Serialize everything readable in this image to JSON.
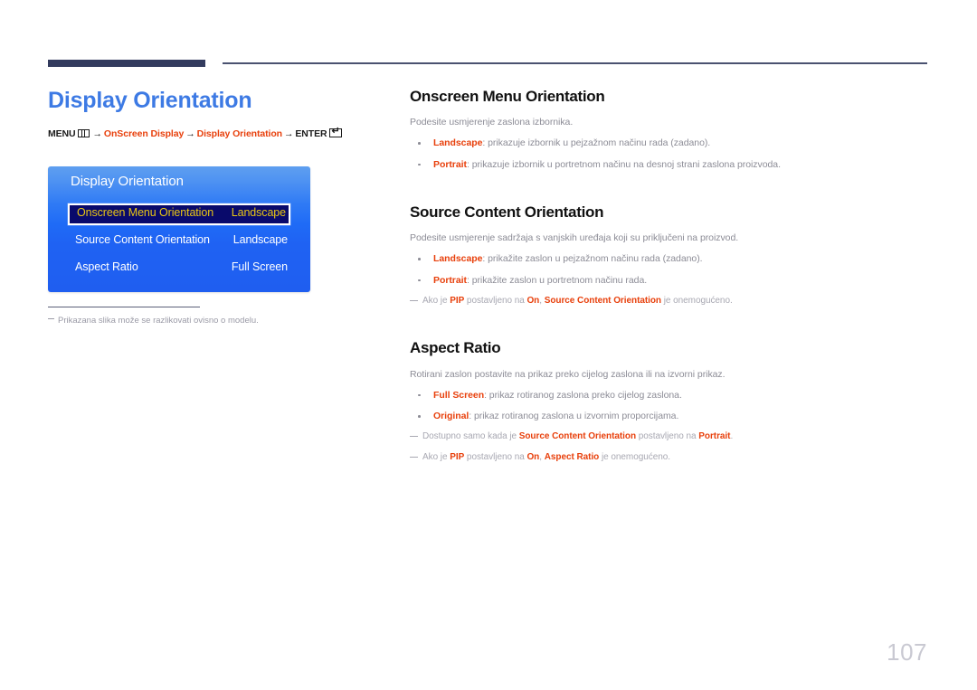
{
  "header": {
    "rule_accent_color": "#333b5e"
  },
  "left": {
    "page_title": "Display Orientation",
    "breadcrumb": {
      "menu_label": "MENU",
      "menu_icon": "menu-grid-icon",
      "arrow": "→",
      "step1": "OnScreen Display",
      "step2": "Display Orientation",
      "enter_label": "ENTER",
      "enter_icon": "enter-return-icon"
    },
    "osd": {
      "title": "Display Orientation",
      "rows": [
        {
          "label": "Onscreen Menu Orientation",
          "value": "Landscape",
          "selected": true
        },
        {
          "label": "Source Content Orientation",
          "value": "Landscape",
          "selected": false
        },
        {
          "label": "Aspect Ratio",
          "value": "Full Screen",
          "selected": false
        }
      ],
      "highlight_bg": "#090a6b",
      "highlight_text": "#e9c614"
    },
    "footnote": "Prikazana slika može se razlikovati ovisno o modelu."
  },
  "right": {
    "sections": [
      {
        "title": "Onscreen Menu Orientation",
        "lead": "Podesite usmjerenje zaslona izbornika.",
        "bullets": [
          {
            "kw": "Landscape",
            "rest": ": prikazuje izbornik u pejzažnom načinu rada (zadano)."
          },
          {
            "kw": "Portrait",
            "rest": ": prikazuje izbornik u portretnom načinu na desnoj strani zaslona proizvoda."
          }
        ],
        "notes": []
      },
      {
        "title": "Source Content Orientation",
        "lead": "Podesite usmjerenje sadržaja s vanjskih uređaja koji su priključeni na proizvod.",
        "bullets": [
          {
            "kw": "Landscape",
            "rest": ": prikažite zaslon u pejzažnom načinu rada (zadano)."
          },
          {
            "kw": "Portrait",
            "rest": ": prikažite zaslon u portretnom načinu rada."
          }
        ],
        "notes": [
          {
            "parts": [
              {
                "t": "Ako je ",
                "b": false
              },
              {
                "t": "PIP",
                "b": true
              },
              {
                "t": " postavljeno na ",
                "b": false
              },
              {
                "t": "On",
                "b": true
              },
              {
                "t": ", ",
                "b": false
              },
              {
                "t": "Source Content Orientation",
                "b": true
              },
              {
                "t": " je onemogućeno.",
                "b": false
              }
            ]
          }
        ]
      },
      {
        "title": "Aspect Ratio",
        "lead": "Rotirani zaslon postavite na prikaz preko cijelog zaslona ili na izvorni prikaz.",
        "bullets": [
          {
            "kw": "Full Screen",
            "rest": ": prikaz rotiranog zaslona preko cijelog zaslona."
          },
          {
            "kw": "Original",
            "rest": ": prikaz rotiranog zaslona u izvornim proporcijama."
          }
        ],
        "notes": [
          {
            "parts": [
              {
                "t": "Dostupno samo kada je ",
                "b": false
              },
              {
                "t": "Source Content Orientation",
                "b": true
              },
              {
                "t": " postavljeno na ",
                "b": false
              },
              {
                "t": "Portrait",
                "b": true
              },
              {
                "t": ".",
                "b": false
              }
            ]
          },
          {
            "parts": [
              {
                "t": "Ako je ",
                "b": false
              },
              {
                "t": "PIP",
                "b": true
              },
              {
                "t": " postavljeno na ",
                "b": false
              },
              {
                "t": "On",
                "b": true
              },
              {
                "t": ", ",
                "b": false
              },
              {
                "t": "Aspect Ratio",
                "b": true
              },
              {
                "t": " je onemogućeno.",
                "b": false
              }
            ]
          }
        ]
      }
    ]
  },
  "footer": {
    "page_number": "107"
  }
}
